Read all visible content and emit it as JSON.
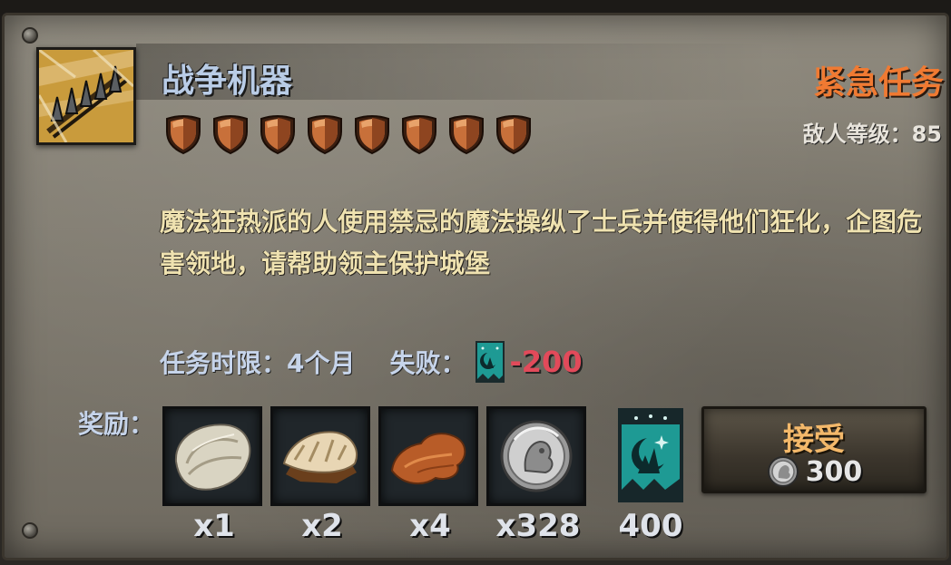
{
  "mission": {
    "title": "战争机器",
    "urgency": "紧急任务",
    "enemy_level": "敌人等级：85",
    "difficulty_shields": 8,
    "description": "魔法狂热派的人使用禁忌的魔法操纵了士兵并使得他们狂化，企图危害领地，请帮助领主保护城堡",
    "time_limit": "任务时限：4个月",
    "failure_label": "失败：",
    "failure_penalty": "-200"
  },
  "rewards": {
    "label": "奖励：",
    "items": [
      {
        "icon": "white-pelt-icon",
        "count": "x1"
      },
      {
        "icon": "fur-pelt-icon",
        "count": "x2"
      },
      {
        "icon": "leather-hide-icon",
        "count": "x4"
      },
      {
        "icon": "silver-coin-icon",
        "count": "x328"
      },
      {
        "icon": "faction-banner-icon",
        "count": "400"
      }
    ]
  },
  "accept_button": {
    "label": "接受",
    "cost": "300",
    "cost_icon": "silver-coin-icon"
  },
  "colors": {
    "title": "#b9cce6",
    "urgent": "#f07a32",
    "description": "#efe2b0",
    "penalty": "#e24a5a",
    "accept": "#f3b86a",
    "banner_teal": "#1e9a94"
  }
}
